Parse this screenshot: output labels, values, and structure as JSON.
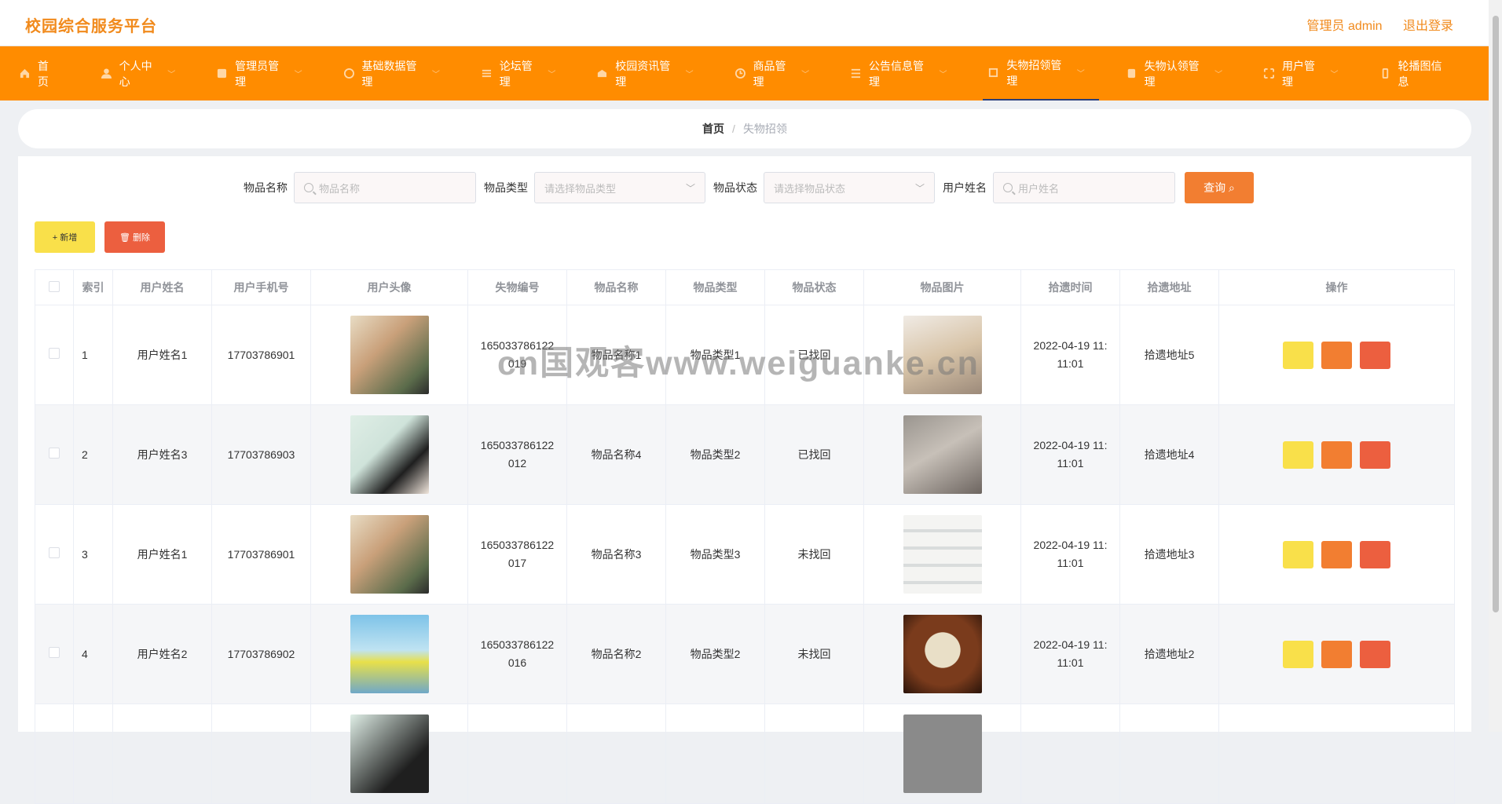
{
  "app": {
    "title": "校园综合服务平台",
    "admin_label": "管理员 admin",
    "logout_label": "退出登录"
  },
  "nav": [
    {
      "label": "首页",
      "icon": "home-icon",
      "has_chevron": false
    },
    {
      "label": "个人中心",
      "icon": "user-icon",
      "has_chevron": true
    },
    {
      "label": "管理员管理",
      "icon": "admin-icon",
      "has_chevron": true
    },
    {
      "label": "基础数据管理",
      "icon": "data-icon",
      "has_chevron": true
    },
    {
      "label": "论坛管理",
      "icon": "forum-icon",
      "has_chevron": true
    },
    {
      "label": "校园资讯管理",
      "icon": "news-icon",
      "has_chevron": true
    },
    {
      "label": "商品管理",
      "icon": "goods-icon",
      "has_chevron": true
    },
    {
      "label": "公告信息管理",
      "icon": "notice-icon",
      "has_chevron": true
    },
    {
      "label": "失物招领管理",
      "icon": "lost-found-icon",
      "has_chevron": true,
      "active": true
    },
    {
      "label": "失物认领管理",
      "icon": "claim-icon",
      "has_chevron": true
    },
    {
      "label": "用户管理",
      "icon": "users-icon",
      "has_chevron": true
    },
    {
      "label": "轮播图信息",
      "icon": "carousel-icon",
      "has_chevron": true
    }
  ],
  "breadcrumb": {
    "home": "首页",
    "separator": "/",
    "current": "失物招领"
  },
  "search": {
    "name_label": "物品名称",
    "name_placeholder": "物品名称",
    "type_label": "物品类型",
    "type_placeholder": "请选择物品类型",
    "status_label": "物品状态",
    "status_placeholder": "请选择物品状态",
    "user_label": "用户姓名",
    "user_placeholder": "用户姓名",
    "query_label": "查询"
  },
  "actions": {
    "add_label": "+ 新增",
    "delete_label": "删除"
  },
  "table": {
    "headers": [
      "索引",
      "用户姓名",
      "用户手机号",
      "用户头像",
      "失物编号",
      "物品名称",
      "物品类型",
      "物品状态",
      "物品图片",
      "拾遗时间",
      "拾遗地址",
      "操作"
    ],
    "rows": [
      {
        "index": "1",
        "user": "用户姓名1",
        "phone": "17703786901",
        "code": "165033786122019",
        "code_l1": "165033786122",
        "code_l2": "019",
        "name": "物品名称1",
        "type": "物品类型1",
        "status": "已找回",
        "time_l1": "2022-04-19 11:",
        "time_l2": "11:01",
        "address": "拾遗地址5"
      },
      {
        "index": "2",
        "user": "用户姓名3",
        "phone": "17703786903",
        "code": "165033786122012",
        "code_l1": "165033786122",
        "code_l2": "012",
        "name": "物品名称4",
        "type": "物品类型2",
        "status": "已找回",
        "time_l1": "2022-04-19 11:",
        "time_l2": "11:01",
        "address": "拾遗地址4"
      },
      {
        "index": "3",
        "user": "用户姓名1",
        "phone": "17703786901",
        "code": "165033786122017",
        "code_l1": "165033786122",
        "code_l2": "017",
        "name": "物品名称3",
        "type": "物品类型3",
        "status": "未找回",
        "time_l1": "2022-04-19 11:",
        "time_l2": "11:01",
        "address": "拾遗地址3"
      },
      {
        "index": "4",
        "user": "用户姓名2",
        "phone": "17703786902",
        "code": "165033786122016",
        "code_l1": "165033786122",
        "code_l2": "016",
        "name": "物品名称2",
        "type": "物品类型2",
        "status": "未找回",
        "time_l1": "2022-04-19 11:",
        "time_l2": "11:01",
        "address": "拾遗地址2"
      }
    ]
  },
  "watermark": "cn国观客www.weiguanke.cn",
  "colors": {
    "accent": "#ff8c00",
    "brand_text": "#f18a1c",
    "btn_yellow": "#f9e04a",
    "btn_orange": "#f27e31",
    "btn_red": "#ec5f3f"
  }
}
